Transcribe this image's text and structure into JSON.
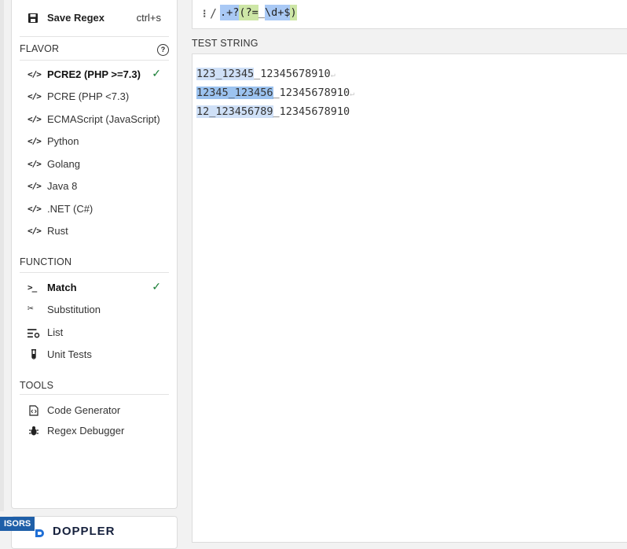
{
  "sidebar": {
    "save": {
      "label": "Save Regex",
      "shortcut": "ctrl+s",
      "icon": "save-icon"
    },
    "flavor": {
      "title": "FLAVOR",
      "help_glyph": "?",
      "items": [
        {
          "label": "PCRE2 (PHP >=7.3)",
          "active": true
        },
        {
          "label": "PCRE (PHP <7.3)",
          "active": false
        },
        {
          "label": "ECMAScript (JavaScript)",
          "active": false
        },
        {
          "label": "Python",
          "active": false
        },
        {
          "label": "Golang",
          "active": false
        },
        {
          "label": "Java 8",
          "active": false
        },
        {
          "label": ".NET (C#)",
          "active": false
        },
        {
          "label": "Rust",
          "active": false
        }
      ]
    },
    "function": {
      "title": "FUNCTION",
      "items": [
        {
          "label": "Match",
          "icon": "terminal-icon",
          "active": true
        },
        {
          "label": "Substitution",
          "icon": "scissors-icon",
          "active": false
        },
        {
          "label": "List",
          "icon": "list-icon",
          "active": false
        },
        {
          "label": "Unit Tests",
          "icon": "test-tube-icon",
          "active": false
        }
      ]
    },
    "tools": {
      "title": "TOOLS",
      "items": [
        {
          "label": "Code Generator",
          "icon": "code-file-icon"
        },
        {
          "label": "Regex Debugger",
          "icon": "bug-icon"
        }
      ]
    }
  },
  "regex": {
    "delimiter": "/",
    "tokens": {
      "any": ".+",
      "lazy": "?",
      "look": "(?=",
      "lit": "_",
      "digits": "\\d+",
      "end": "$",
      "close": ")"
    }
  },
  "test_string": {
    "label": "TEST STRING",
    "newline_glyph": "↵",
    "lines": [
      {
        "match": "123_12345",
        "rest": "_12345678910"
      },
      {
        "match": "12345_123456",
        "rest": "_12345678910"
      },
      {
        "match": "12_123456789",
        "rest": "_12345678910"
      }
    ]
  },
  "sponsor": {
    "tag": "ISORS",
    "name": "DOPPLER"
  },
  "colors": {
    "check": "#1a7f37",
    "match_light": "#cfe0f7",
    "match_dark": "#9cc3f0",
    "token_blue": "#a9c9f5",
    "token_green": "#cde6a6"
  }
}
